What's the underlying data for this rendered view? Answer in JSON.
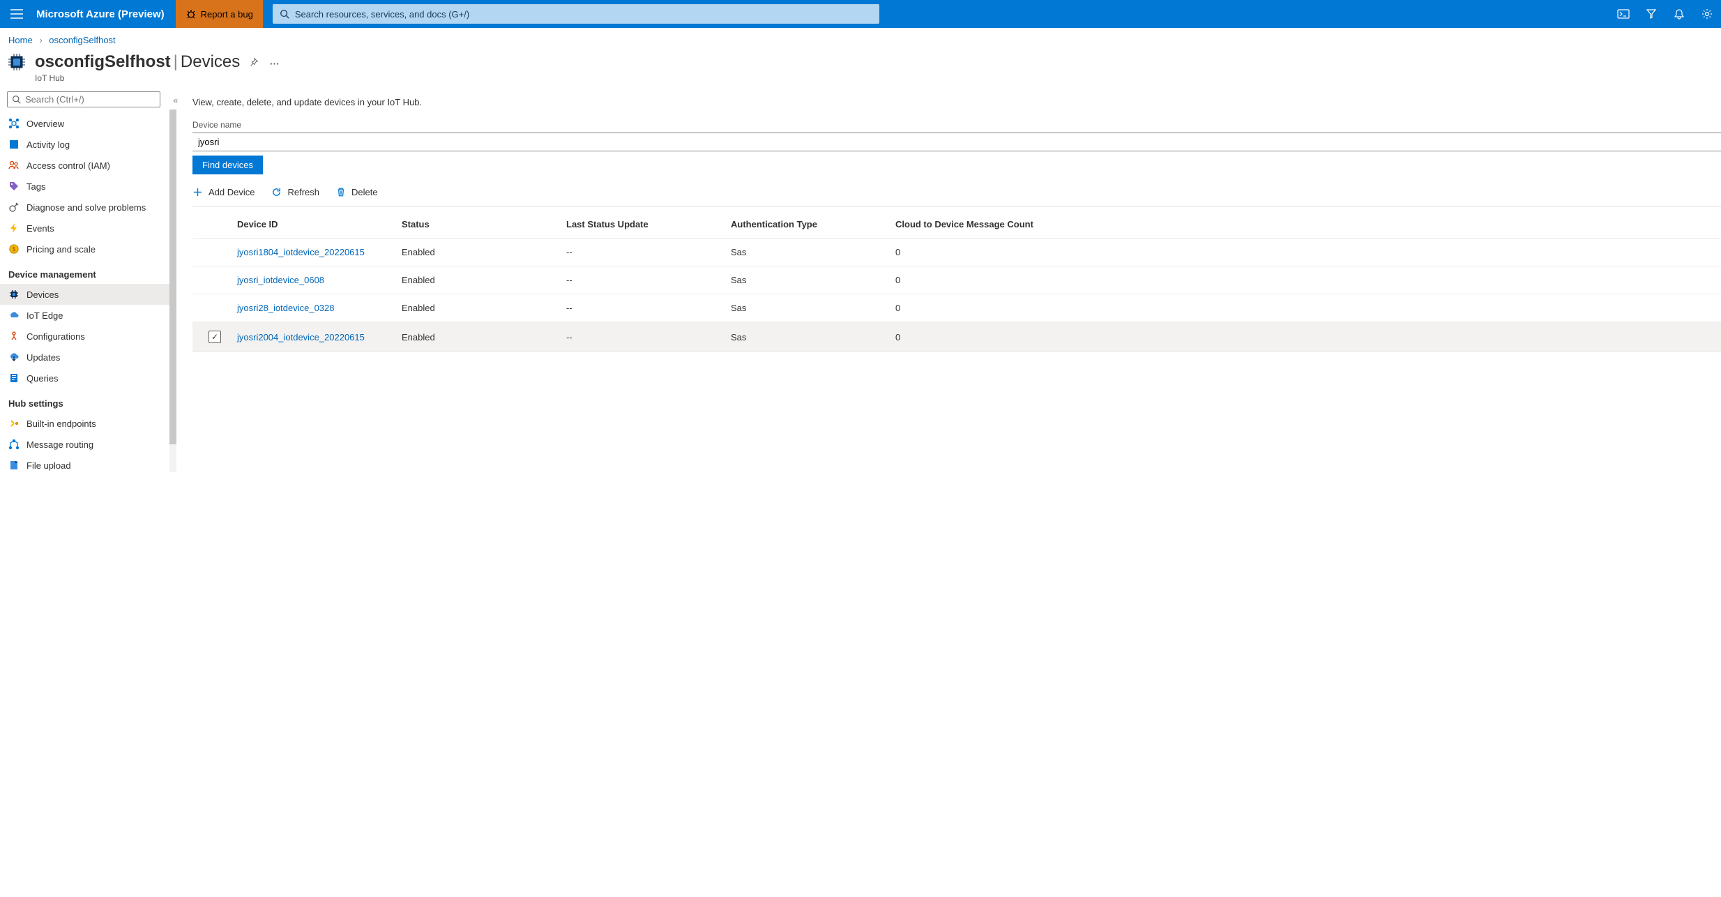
{
  "topbar": {
    "brand": "Microsoft Azure (Preview)",
    "bug_label": "Report a bug",
    "search_placeholder": "Search resources, services, and docs (G+/)"
  },
  "breadcrumb": {
    "home": "Home",
    "current": "osconfigSelfhost"
  },
  "title": {
    "name": "osconfigSelfhost",
    "section": "Devices",
    "service": "IoT Hub"
  },
  "sidebar": {
    "search_placeholder": "Search (Ctrl+/)",
    "items_top": [
      {
        "label": "Overview",
        "icon": "overview"
      },
      {
        "label": "Activity log",
        "icon": "activity"
      },
      {
        "label": "Access control (IAM)",
        "icon": "iam"
      },
      {
        "label": "Tags",
        "icon": "tags"
      },
      {
        "label": "Diagnose and solve problems",
        "icon": "diagnose"
      },
      {
        "label": "Events",
        "icon": "events"
      },
      {
        "label": "Pricing and scale",
        "icon": "pricing"
      }
    ],
    "section_device": "Device management",
    "items_device": [
      {
        "label": "Devices",
        "icon": "devices",
        "selected": true
      },
      {
        "label": "IoT Edge",
        "icon": "edge"
      },
      {
        "label": "Configurations",
        "icon": "config"
      },
      {
        "label": "Updates",
        "icon": "updates"
      },
      {
        "label": "Queries",
        "icon": "queries"
      }
    ],
    "section_hub": "Hub settings",
    "items_hub": [
      {
        "label": "Built-in endpoints",
        "icon": "endpoints"
      },
      {
        "label": "Message routing",
        "icon": "routing"
      },
      {
        "label": "File upload",
        "icon": "upload"
      }
    ]
  },
  "main": {
    "description": "View, create, delete, and update devices in your IoT Hub.",
    "device_name_label": "Device name",
    "device_name_value": "jyosri",
    "find_button": "Find devices",
    "toolbar": {
      "add": "Add Device",
      "refresh": "Refresh",
      "delete": "Delete"
    },
    "columns": {
      "device_id": "Device ID",
      "status": "Status",
      "last_update": "Last Status Update",
      "auth_type": "Authentication Type",
      "msg_count": "Cloud to Device Message Count"
    },
    "rows": [
      {
        "id": "jyosri1804_iotdevice_20220615",
        "status": "Enabled",
        "last": "--",
        "auth": "Sas",
        "count": "0",
        "checked": false
      },
      {
        "id": "jyosri_iotdevice_0608",
        "status": "Enabled",
        "last": "--",
        "auth": "Sas",
        "count": "0",
        "checked": false
      },
      {
        "id": "jyosri28_iotdevice_0328",
        "status": "Enabled",
        "last": "--",
        "auth": "Sas",
        "count": "0",
        "checked": false
      },
      {
        "id": "jyosri2004_iotdevice_20220615",
        "status": "Enabled",
        "last": "--",
        "auth": "Sas",
        "count": "0",
        "checked": true
      }
    ]
  }
}
